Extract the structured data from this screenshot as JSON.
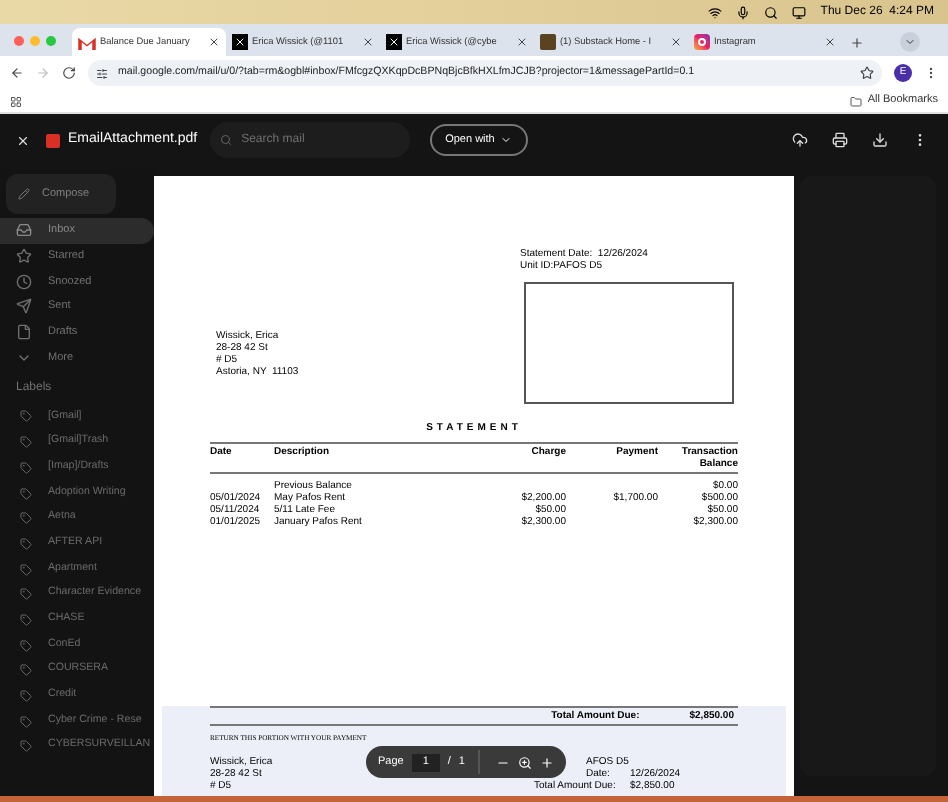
{
  "menu_bar": {
    "clock": "Thu Dec 26  4:24 PM"
  },
  "tabs": [
    {
      "title": "Balance Due January",
      "selected": true,
      "kind": "gmail"
    },
    {
      "title": "Erica Wissick (@1101",
      "selected": false,
      "kind": "x"
    },
    {
      "title": "Erica Wissick (@cybe",
      "selected": false,
      "kind": "x"
    },
    {
      "title": "(1) Substack Home - I",
      "selected": false,
      "kind": "substack"
    },
    {
      "title": "Instagram",
      "selected": false,
      "kind": "instagram"
    }
  ],
  "address_bar": {
    "url": "mail.google.com/mail/u/0/?tab=rm&ogbl#inbox/FMfcgzQXKqpDcBPNqBjcBfkHXLfmJCJB?projector=1&messagePartId=0.1",
    "profile": "E"
  },
  "bookmarks_bar": {
    "all_bookmarks": "All Bookmarks"
  },
  "viewer": {
    "file_name": "EmailAttachment.pdf",
    "search_placeholder": "Search mail",
    "open_with": "Open with"
  },
  "sidebar": {
    "compose": "Compose",
    "items": [
      {
        "label": "Inbox",
        "selected": true,
        "kind": "inbox"
      },
      {
        "label": "Starred",
        "selected": false,
        "kind": "star"
      },
      {
        "label": "Snoozed",
        "selected": false,
        "kind": "clock"
      },
      {
        "label": "Sent",
        "selected": false,
        "kind": "send"
      },
      {
        "label": "Drafts",
        "selected": false,
        "kind": "file"
      },
      {
        "label": "More",
        "selected": false,
        "kind": "more"
      }
    ],
    "labels_heading": "Labels",
    "labels": [
      "[Gmail]",
      "[Gmail]Trash",
      "[Imap]/Drafts",
      "Adoption Writing",
      "Aetna",
      "AFTER API",
      "Apartment",
      "Character Evidence",
      "CHASE",
      "ConEd",
      "COURSERA",
      "Credit",
      "Cyber Crime - Rese",
      "CYBERSURVEILLAN"
    ]
  },
  "document": {
    "statement_date": "Statement Date:  12/26/2024",
    "unit_id": "Unit ID:PAFOS D5",
    "address": [
      "Wissick, Erica",
      "28-28 42 St",
      "# D5",
      "Astoria, NY  11103"
    ],
    "title": "STATEMENT",
    "columns": [
      "Date",
      "Description",
      "Charge",
      "Payment",
      "Transaction Balance"
    ],
    "rows": [
      [
        "",
        "Previous Balance",
        "",
        "",
        "$0.00"
      ],
      [
        "05/01/2024",
        "May Pafos Rent",
        "$2,200.00",
        "$1,700.00",
        "$500.00"
      ],
      [
        "05/11/2024",
        "5/11 Late Fee",
        "$50.00",
        "",
        "$50.00"
      ],
      [
        "01/01/2025",
        "January Pafos Rent",
        "$2,300.00",
        "",
        "$2,300.00"
      ]
    ],
    "total_label": "Total Amount Due:",
    "total": "$2,850.00",
    "return_note": "RETURN THIS PORTION WITH YOUR PAYMENT",
    "stub_address": [
      "Wissick, Erica",
      "28-28 42 St",
      "# D5"
    ],
    "stub_unit": "AFOS D5",
    "stub_date_label": "Date:",
    "stub_date": "12/26/2024",
    "stub_total_label": "Total Amount Due:",
    "stub_total": "$2,850.00"
  },
  "page_controls": {
    "label": "Page",
    "page": "1",
    "separator": "/",
    "total": "1"
  }
}
